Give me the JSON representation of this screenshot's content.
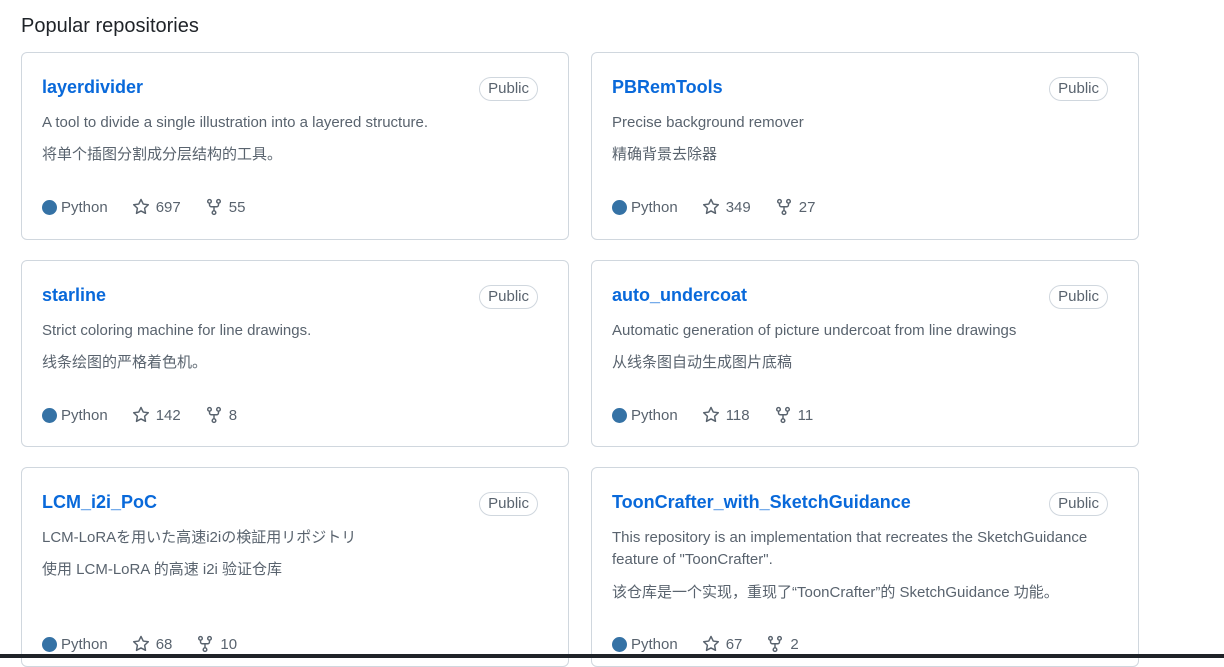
{
  "section": {
    "title": "Popular repositories"
  },
  "repos": [
    {
      "name": "layerdivider",
      "visibility": "Public",
      "desc1": "A tool to divide a single illustration into a layered structure.",
      "desc2": "将单个插图分割成分层结构的工具。",
      "desc3": "",
      "language": "Python",
      "language_color": "#3572A5",
      "stars": "697",
      "forks": "55"
    },
    {
      "name": "PBRemTools",
      "visibility": "Public",
      "desc1": "Precise background remover",
      "desc2": "精确背景去除器",
      "desc3": "",
      "language": "Python",
      "language_color": "#3572A5",
      "stars": "349",
      "forks": "27"
    },
    {
      "name": "starline",
      "visibility": "Public",
      "desc1": "Strict coloring machine for line drawings.",
      "desc2": "线条绘图的严格着色机。",
      "desc3": "",
      "language": "Python",
      "language_color": "#3572A5",
      "stars": "142",
      "forks": "8"
    },
    {
      "name": "auto_undercoat",
      "visibility": "Public",
      "desc1": "Automatic generation of picture undercoat from line drawings",
      "desc2": "从线条图自动生成图片底稿",
      "desc3": "",
      "language": "Python",
      "language_color": "#3572A5",
      "stars": "118",
      "forks": "11"
    },
    {
      "name": "LCM_i2i_PoC",
      "visibility": "Public",
      "desc1": "LCM-LoRAを用いた高速i2iの検証用リポジトリ",
      "desc2": "使用 LCM-LoRA 的高速 i2i 验证仓库",
      "desc3": "",
      "language": "Python",
      "language_color": "#3572A5",
      "stars": "68",
      "forks": "10"
    },
    {
      "name": "ToonCrafter_with_SketchGuidance",
      "visibility": "Public",
      "desc1": "This repository is an implementation that recreates the SketchGuidance",
      "desc2": "feature of \"ToonCrafter\".",
      "desc3": "该仓库是一个实现，重现了“ToonCrafter”的 SketchGuidance 功能。",
      "language": "Python",
      "language_color": "#3572A5",
      "stars": "67",
      "forks": "2"
    }
  ]
}
